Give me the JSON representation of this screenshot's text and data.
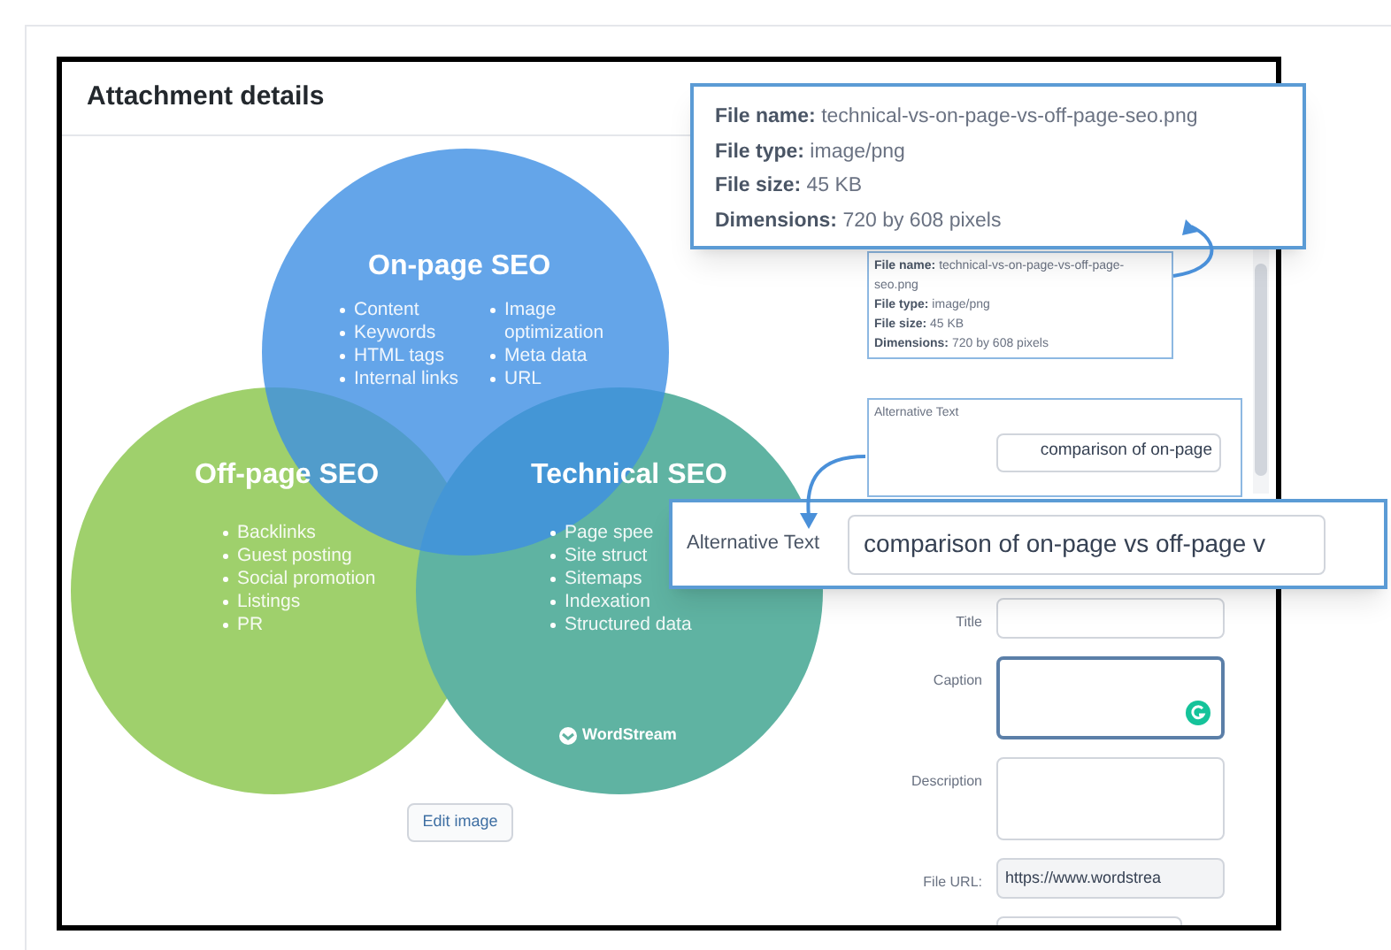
{
  "header": {
    "title": "Attachment details"
  },
  "image": {
    "circles": [
      {
        "kind": "top",
        "title": "On-page SEO",
        "color": "#3d8fe3",
        "columns": [
          [
            "Content",
            "Keywords",
            "HTML tags",
            "Internal links"
          ],
          [
            "Image optimization",
            "Meta data",
            "URL"
          ]
        ]
      },
      {
        "kind": "left",
        "title": "Off-page SEO",
        "color": "#9fd06c",
        "columns": [
          [
            "Backlinks",
            "Guest posting",
            "Social promotion",
            "Listings",
            "PR"
          ]
        ]
      },
      {
        "kind": "right",
        "title": "Technical SEO",
        "color": "#5fb3a2",
        "columns": [
          [
            "Page spee",
            "Site struct",
            "Sitemaps",
            "Indexation",
            "Structured data"
          ]
        ]
      }
    ],
    "logo": "WordStream"
  },
  "edit_button": "Edit image",
  "file_info": [
    {
      "label": "File name:",
      "value": "technical-vs-on-page-vs-off-page-seo.png"
    },
    {
      "label": "File type:",
      "value": "image/png"
    },
    {
      "label": "File size:",
      "value": "45 KB"
    },
    {
      "label": "Dimensions:",
      "value": "720 by 608 pixels"
    }
  ],
  "alt_text": {
    "label": "Alternative Text",
    "value": "comparison of on-page"
  },
  "fields": [
    {
      "label": "Title",
      "kind": "input"
    },
    {
      "label": "Caption",
      "kind": "textarea",
      "focused": true
    },
    {
      "label": "Description",
      "kind": "textarea",
      "focused": false
    },
    {
      "label": "File URL:",
      "kind": "readonly",
      "value": "https://www.wordstrea"
    }
  ],
  "callouts": [
    {
      "kind": "file_info",
      "lines": [
        {
          "label": "File name:",
          "value": "technical-vs-on-page-vs-off-page-seo.png"
        },
        {
          "label": "File type:",
          "value": "image/png"
        },
        {
          "label": "File size:",
          "value": "45 KB"
        },
        {
          "label": "Dimensions:",
          "value": "720 by 608 pixels"
        }
      ]
    },
    {
      "kind": "alt_text",
      "label": "Alternative Text",
      "value": "comparison of on-page vs off-page v"
    }
  ]
}
